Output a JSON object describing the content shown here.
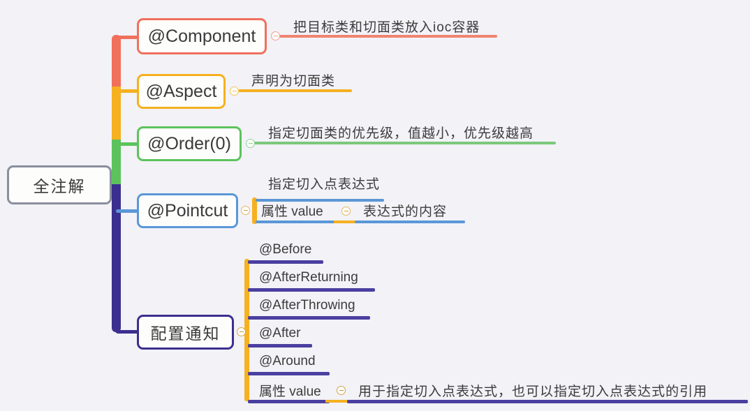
{
  "diagram": {
    "title": "全注解",
    "background": "#F2F2F7",
    "root": {
      "label": "全注解",
      "border_color": "#8A8F9E"
    }
  },
  "branches": [
    {
      "id": "component",
      "label": "@Component",
      "color": "#F0705C",
      "annotation": "把目标类和切面类放入ioc容器",
      "toggle": "collapse-toggle"
    },
    {
      "id": "aspect",
      "label": "@Aspect",
      "color": "#F5B120",
      "annotation": "声明为切面类",
      "toggle": "collapse-toggle"
    },
    {
      "id": "order",
      "label": "@Order(0)",
      "color": "#5CC35C",
      "annotation": "指定切面类的优先级，值越小，优先级越高",
      "toggle": "collapse-toggle"
    },
    {
      "id": "pointcut",
      "label": "@Pointcut",
      "color": "#5B97D6",
      "annotation": "指定切入点表达式",
      "toggle": "collapse-toggle",
      "children": [
        {
          "label": "属性 value",
          "color": "#5B97D6",
          "annotation": "表达式的内容",
          "toggle": "collapse-toggle"
        }
      ]
    },
    {
      "id": "notify",
      "label": "配置通知",
      "color": "#3B2F8F",
      "toggle": "collapse-toggle",
      "children": [
        {
          "label": "@Before",
          "color": "#4B3FA0"
        },
        {
          "label": "@AfterReturning",
          "color": "#4B3FA0"
        },
        {
          "label": "@AfterThrowing",
          "color": "#4B3FA0"
        },
        {
          "label": "@After",
          "color": "#4B3FA0"
        },
        {
          "label": "@Around",
          "color": "#4B3FA0"
        },
        {
          "label": "属性 value",
          "color": "#4B3FA0",
          "annotation": "用于指定切入点表达式，也可以指定切入点表达式的引用",
          "toggle": "collapse-toggle"
        }
      ]
    }
  ],
  "spine_segments": [
    {
      "color": "#F0705C",
      "name": "spine-segment-red"
    },
    {
      "color": "#F5B120",
      "name": "spine-segment-amber"
    },
    {
      "color": "#5CC35C",
      "name": "spine-segment-green"
    },
    {
      "color": "#3B2F8F",
      "name": "spine-segment-indigo"
    }
  ]
}
